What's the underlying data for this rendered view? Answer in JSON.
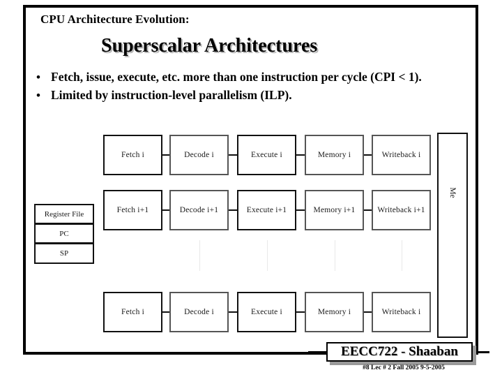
{
  "slide": {
    "kicker": "CPU Architecture Evolution:",
    "title": "Superscalar Architectures",
    "bullets": [
      {
        "marker": "•",
        "text": "Fetch, issue, execute, etc. more than one instruction per cycle (CPI < 1)."
      },
      {
        "marker": "•",
        "text": "Limited by instruction-level parallelism (ILP)."
      }
    ]
  },
  "diagram": {
    "register_file": [
      {
        "label": "Register File"
      },
      {
        "label": "PC"
      },
      {
        "label": "SP"
      }
    ],
    "rows": [
      {
        "name": "instruction-i-top",
        "stages": [
          {
            "label": "Fetch i"
          },
          {
            "label": "Decode i"
          },
          {
            "label": "Execute i"
          },
          {
            "label": "Memory i"
          },
          {
            "label": "Writeback i"
          }
        ]
      },
      {
        "name": "instruction-i-plus-1",
        "stages": [
          {
            "label": "Fetch i+1"
          },
          {
            "label": "Decode i+1"
          },
          {
            "label": "Execute i+1"
          },
          {
            "label": "Memory i+1"
          },
          {
            "label": "Writeback i+1"
          }
        ]
      },
      {
        "name": "instruction-i-bottom",
        "stages": [
          {
            "label": "Fetch i"
          },
          {
            "label": "Decode i"
          },
          {
            "label": "Execute i"
          },
          {
            "label": "Memory i"
          },
          {
            "label": "Writeback i"
          }
        ]
      }
    ],
    "memory_column": {
      "label": "Me"
    }
  },
  "footer": {
    "title": "EECC722 - Shaaban",
    "meta": "#8   Lec # 2   Fall 2005  9-5-2005"
  },
  "colors": {
    "ink": "#000000",
    "box_border": "#111111",
    "shadow": "#b8b8b8",
    "footer_shadow": "#9a9a9a",
    "dots": "#e8e8e8"
  }
}
